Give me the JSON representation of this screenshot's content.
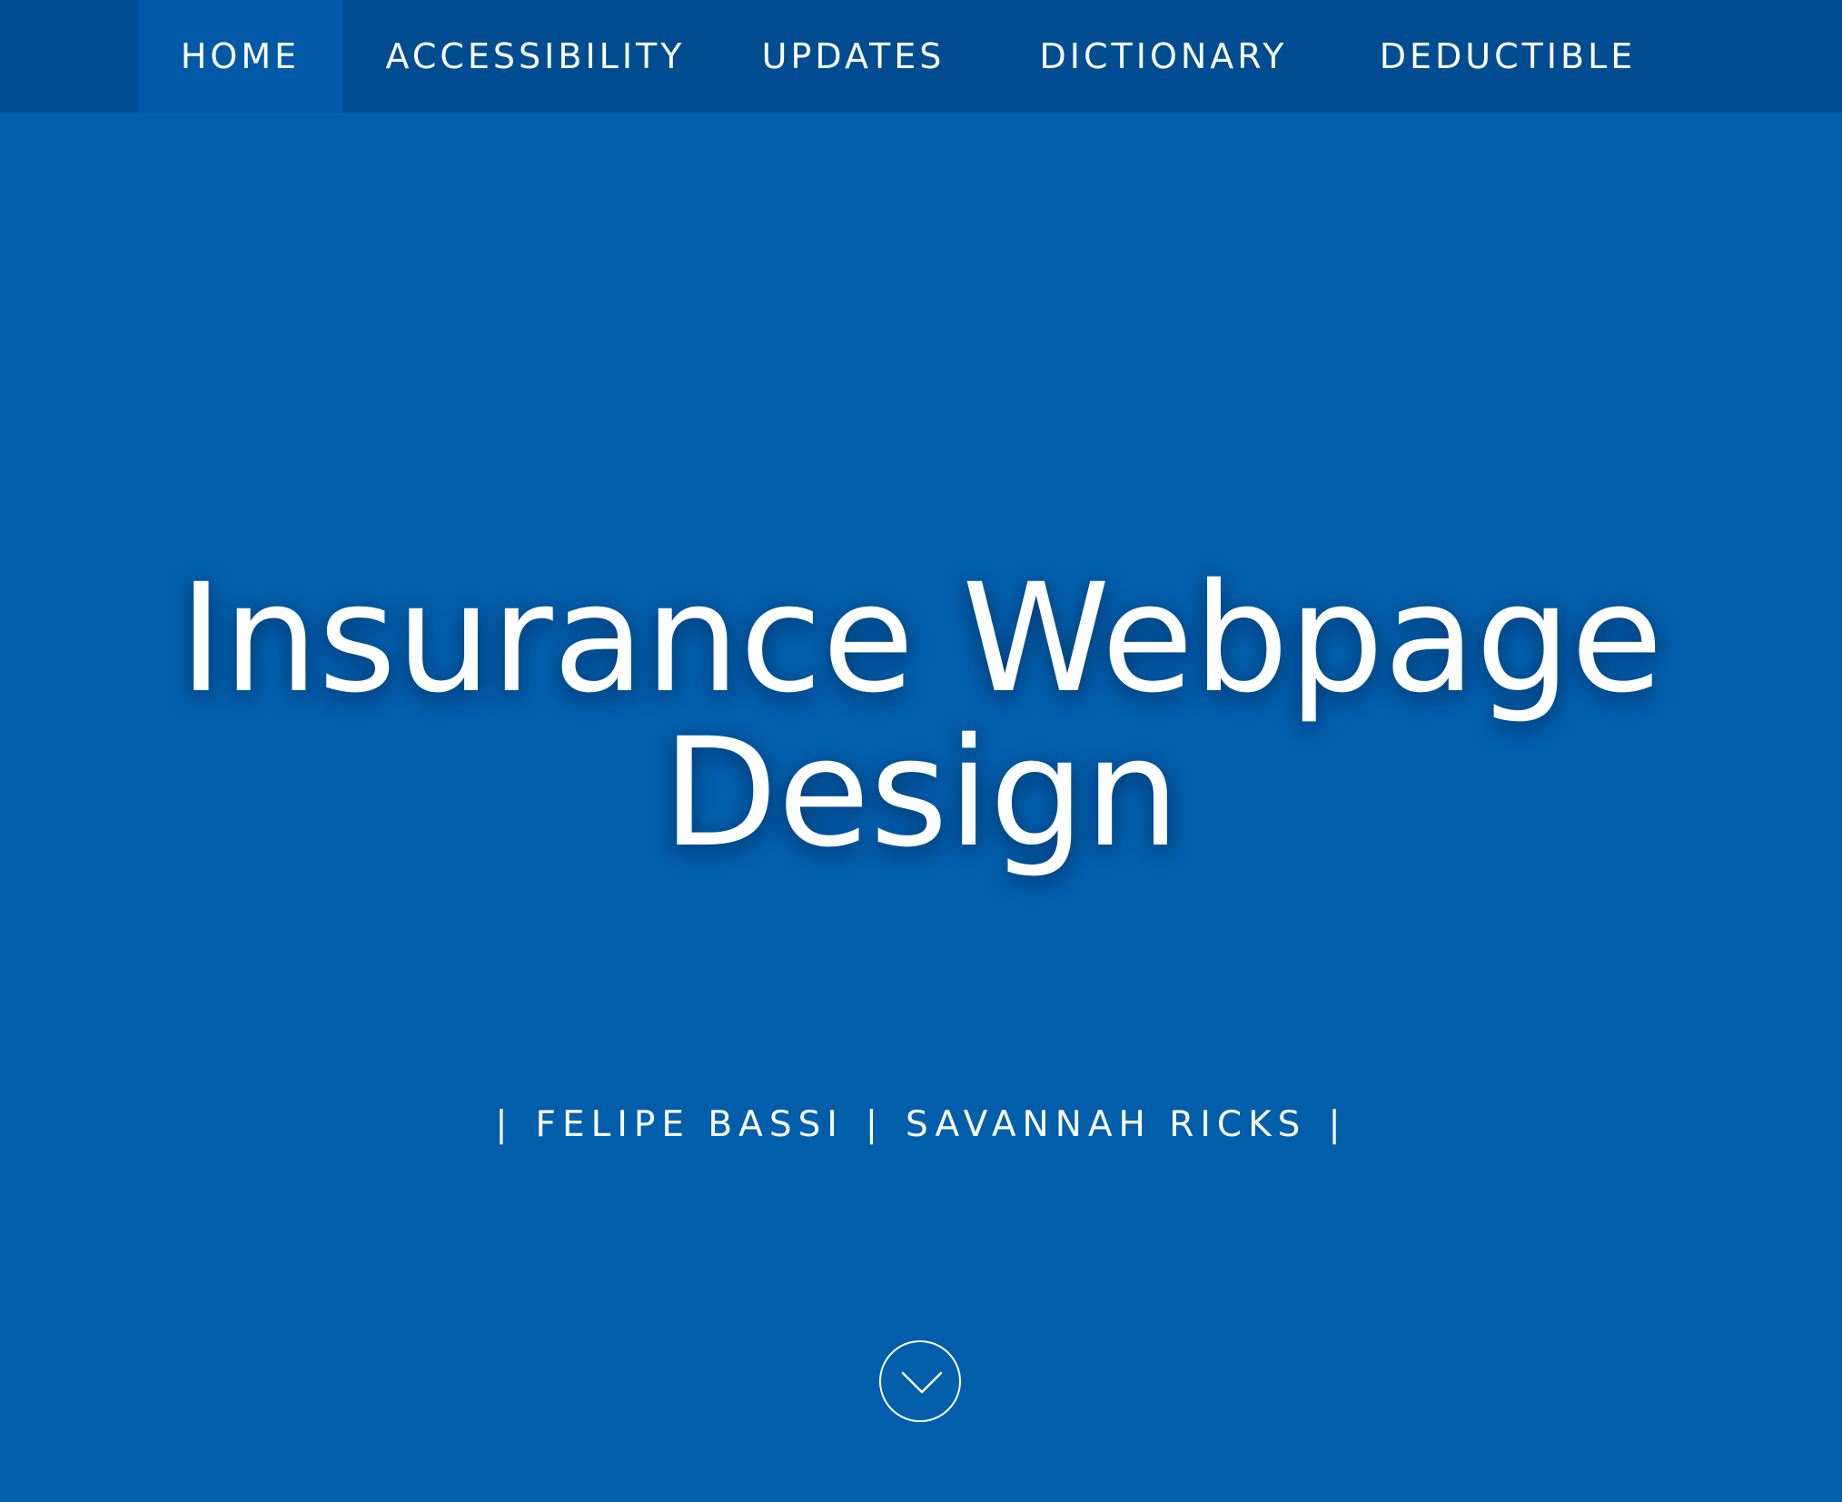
{
  "nav": {
    "items": [
      {
        "label": "HOME",
        "active": true
      },
      {
        "label": "ACCESSIBILITY",
        "active": false
      },
      {
        "label": "UPDATES",
        "active": false
      },
      {
        "label": "DICTIONARY",
        "active": false
      },
      {
        "label": "DEDUCTIBLE",
        "active": false
      }
    ]
  },
  "hero": {
    "title_line1": "Insurance Webpage",
    "title_line2": "Design"
  },
  "authors": {
    "separator": "|",
    "names": [
      "FELIPE BASSI",
      "SAVANNAH RICKS"
    ]
  },
  "scroll": {
    "icon": "chevron-down-icon"
  },
  "colors": {
    "background": "#005eab",
    "navbar": "#004c90",
    "nav_active": "#0058a6",
    "text": "#ffffff"
  }
}
